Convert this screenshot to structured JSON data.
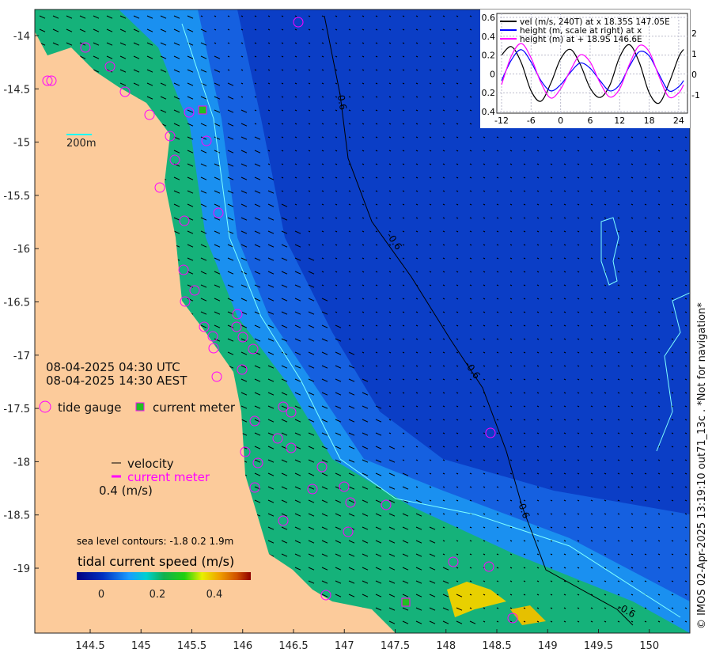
{
  "map": {
    "x_ticks": [
      "144.5",
      "145",
      "145.5",
      "146",
      "146.5",
      "147",
      "147.5",
      "148",
      "148.5",
      "149",
      "149.5",
      "150"
    ],
    "y_ticks": [
      "-14",
      "-14.5",
      "-15",
      "-15.5",
      "-16",
      "-16.5",
      "-17",
      "-17.5",
      "-18",
      "-18.5",
      "-19"
    ],
    "scale_label": "200m",
    "time_utc": "08-04-2025 04:30 UTC",
    "time_local": "08-04-2025 14:30 AEST",
    "legend": {
      "tide_gauge": "tide gauge",
      "current_meter": "current meter",
      "velocity": "velocity",
      "current_meter_arrow": "current meter",
      "arrow_scale": "0.4 (m/s)"
    },
    "contours_label": "sea level contours: -1.8 0.2 1.9m",
    "contour_label": "-0.6",
    "colorbar": {
      "title": "tidal current speed (m/s)",
      "ticks": [
        "0",
        "0.2",
        "0.4"
      ],
      "range": [
        -0.05,
        0.55
      ]
    },
    "credit": "© IMOS 02-Apr-2025 13:19:10 out71_13c . *Not for navigation*",
    "colors": {
      "land": "#fccb9b",
      "deep_ocean": "#0b3ec6",
      "shelf": "#19b36a",
      "tide_gauge": "#ff00ff",
      "contour": "#000000",
      "isobath": "#7fffff"
    }
  },
  "chart_data": {
    "type": "line",
    "x": [
      -12,
      -10,
      -8,
      -6,
      -4,
      -2,
      0,
      2,
      4,
      6,
      8,
      10,
      12,
      14,
      16,
      18,
      20,
      22,
      24,
      25
    ],
    "x_ticks": [
      "-12",
      "-6",
      "0",
      "6",
      "12",
      "18",
      "24"
    ],
    "y_ticks_left": [
      "0.6",
      "0.4",
      "0.2",
      "0",
      "0.2",
      "0.4"
    ],
    "y_ticks_right": [
      "2",
      "1",
      "0",
      "-1"
    ],
    "ylim_left": [
      -0.4,
      0.6
    ],
    "ylim_right": [
      -1.8,
      2.0
    ],
    "grid": true,
    "legend_placement": "top",
    "series": [
      {
        "name": "vel (m/s, 240T) at x 18.35S 147.05E",
        "axis": "left",
        "color": "#000000",
        "values": [
          0.2,
          0.29,
          0.12,
          -0.18,
          -0.29,
          -0.1,
          0.16,
          0.26,
          0.1,
          -0.15,
          -0.25,
          -0.12,
          0.18,
          0.31,
          0.12,
          -0.2,
          -0.31,
          -0.1,
          0.18,
          0.26
        ]
      },
      {
        "name": "height (m, scale at right) at x",
        "axis": "right",
        "color": "#0000ff",
        "values": [
          -0.3,
          0.7,
          1.2,
          0.6,
          -0.3,
          -0.8,
          -0.5,
          0.1,
          0.55,
          0.3,
          -0.3,
          -0.8,
          -0.5,
          0.4,
          1.1,
          0.9,
          0,
          -0.8,
          -0.6,
          -0.3
        ]
      },
      {
        "name": "height (m) at + 18.9S 146.6E",
        "axis": "right",
        "color": "#ff00ff",
        "values": [
          -0.5,
          0.9,
          1.5,
          0.8,
          -0.4,
          -1.15,
          -0.7,
          0.2,
          0.95,
          0.6,
          -0.4,
          -1.1,
          -0.7,
          0.5,
          1.4,
          1.1,
          -0.1,
          -1.1,
          -0.9,
          -0.5
        ]
      }
    ]
  }
}
